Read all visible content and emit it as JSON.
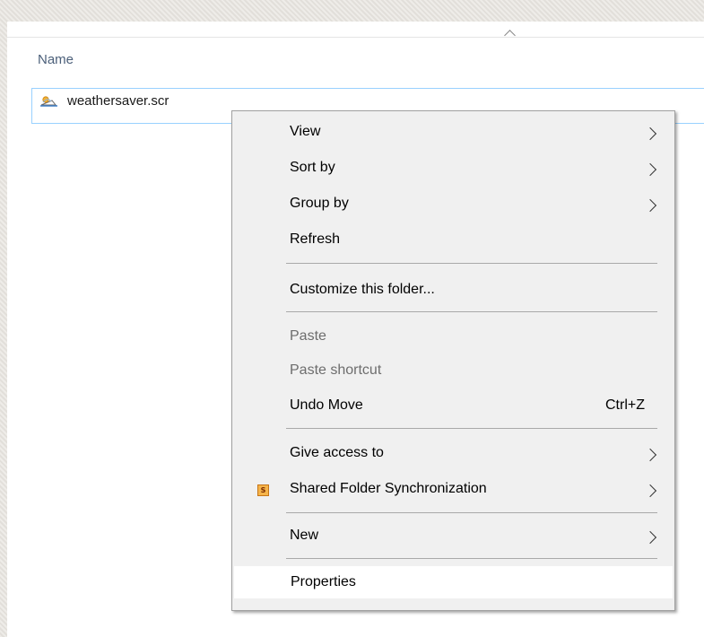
{
  "explorer": {
    "column_header": "Name",
    "file": {
      "name": "weathersaver.scr",
      "icon": "screensaver-file-icon"
    }
  },
  "context_menu": {
    "items": [
      {
        "label": "View",
        "submenu": true
      },
      {
        "label": "Sort by",
        "submenu": true
      },
      {
        "label": "Group by",
        "submenu": true
      },
      {
        "label": "Refresh"
      },
      {
        "label": "Customize this folder..."
      },
      {
        "label": "Paste",
        "disabled": true
      },
      {
        "label": "Paste shortcut",
        "disabled": true
      },
      {
        "label": "Undo Move",
        "shortcut": "Ctrl+Z"
      },
      {
        "label": "Give access to",
        "submenu": true
      },
      {
        "label": "Shared Folder Synchronization",
        "submenu": true,
        "icon": "sync-app-icon",
        "icon_text": "S"
      },
      {
        "label": "New",
        "submenu": true
      },
      {
        "label": "Properties",
        "highlighted": true
      }
    ]
  },
  "colors": {
    "selection_border": "#99d1ff",
    "menu_background": "#f0f0f0",
    "header_text": "#4c607a",
    "disabled_text": "#6d6d6d"
  }
}
